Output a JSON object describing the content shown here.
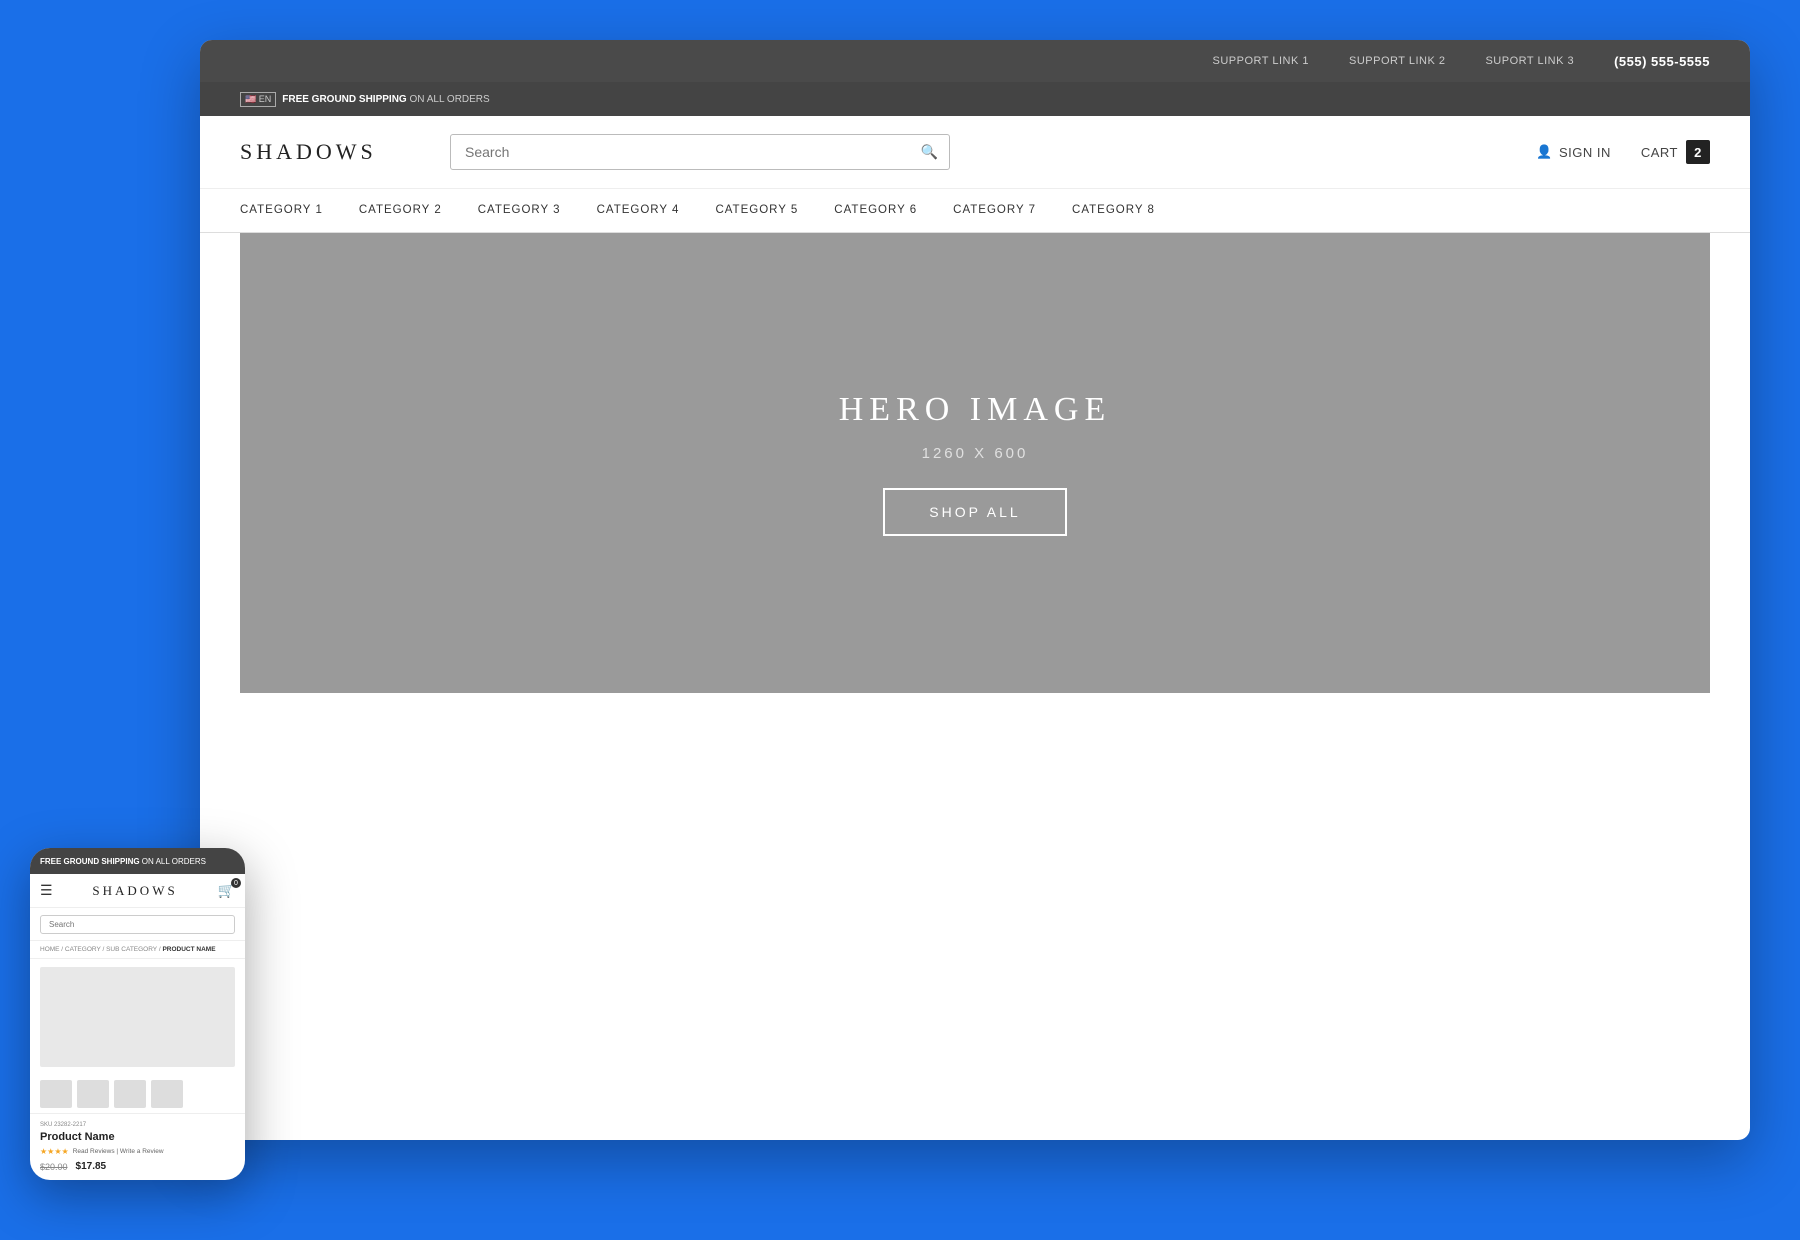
{
  "support_bar": {
    "link1": "SUPPORT LINK 1",
    "link2": "SUPPORT LINK 2",
    "link3": "SUPORT LINK 3",
    "phone": "(555) 555-5555"
  },
  "header": {
    "shipping_highlight": "FREE GROUND SHIPPING",
    "shipping_rest": " ON ALL ORDERS",
    "lang": "EN",
    "logo": "SHADOWS",
    "search_placeholder": "Search",
    "sign_in": "SIGN IN",
    "cart_label": "CART",
    "cart_count": "2"
  },
  "nav": {
    "items": [
      "CATEGORY 1",
      "CATEGORY 2",
      "CATEGORY 3",
      "CATEGORY 4",
      "CATEGORY 5",
      "CATEGORY 6",
      "CATEGORY 7",
      "CATEGORY 8"
    ]
  },
  "hero": {
    "title": "HERO IMAGE",
    "subtitle": "1260 X 600",
    "cta": "SHOP ALL"
  },
  "mobile": {
    "shipping_highlight": "FREE GROUND SHIPPING",
    "shipping_rest": " ON ALL ORDERS",
    "logo": "SHADOWS",
    "search_placeholder": "Search",
    "breadcrumb_prefix": "HOME / CATEGORY / SUB CATEGORY /",
    "breadcrumb_product": " PRODUCT NAME",
    "sku": "SKU 23282-2217",
    "product_name": "Product Name",
    "stars": "★★★★",
    "read_reviews": "Read Reviews",
    "write_review": "Write a Review",
    "original_price": "$20.00",
    "sale_price": "$17.85",
    "cart_badge": "0"
  },
  "colors": {
    "background": "#1a6fe8",
    "support_bar": "#4a4a4a",
    "accent": "#222222",
    "hero_bg": "#9a9a9a"
  }
}
